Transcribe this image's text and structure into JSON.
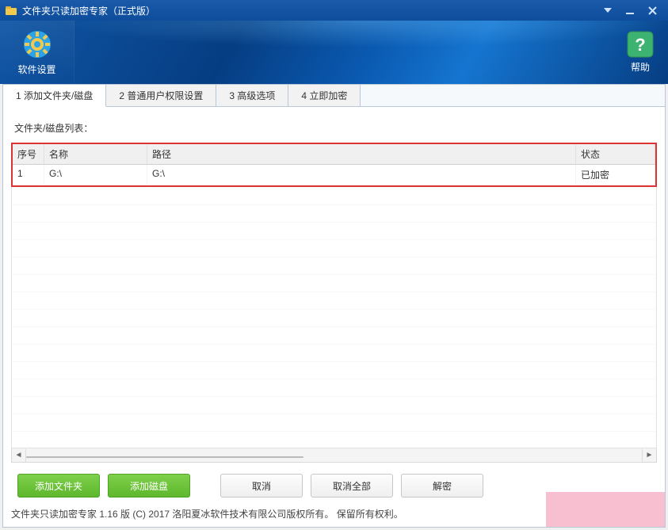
{
  "window": {
    "title": "文件夹只读加密专家（正式版）"
  },
  "toolbar": {
    "settings_label": "软件设置",
    "help_label": "帮助"
  },
  "tabs": [
    {
      "label": "1 添加文件夹/磁盘",
      "active": true
    },
    {
      "label": "2 普通用户权限设置",
      "active": false
    },
    {
      "label": "3 高级选项",
      "active": false
    },
    {
      "label": "4 立即加密",
      "active": false
    }
  ],
  "panel": {
    "list_label": "文件夹/磁盘列表：",
    "columns": {
      "index": "序号",
      "name": "名称",
      "path": "路径",
      "status": "状态"
    },
    "rows": [
      {
        "index": "1",
        "name": "G:\\",
        "path": "G:\\",
        "status": "已加密"
      }
    ]
  },
  "buttons": {
    "add_folder": "添加文件夹",
    "add_disk": "添加磁盘",
    "cancel": "取消",
    "cancel_all": "取消全部",
    "decrypt": "解密"
  },
  "status": "文件夹只读加密专家 1.16 版  (C)  2017 洛阳夏冰软件技术有限公司版权所有。 保留所有权利。"
}
